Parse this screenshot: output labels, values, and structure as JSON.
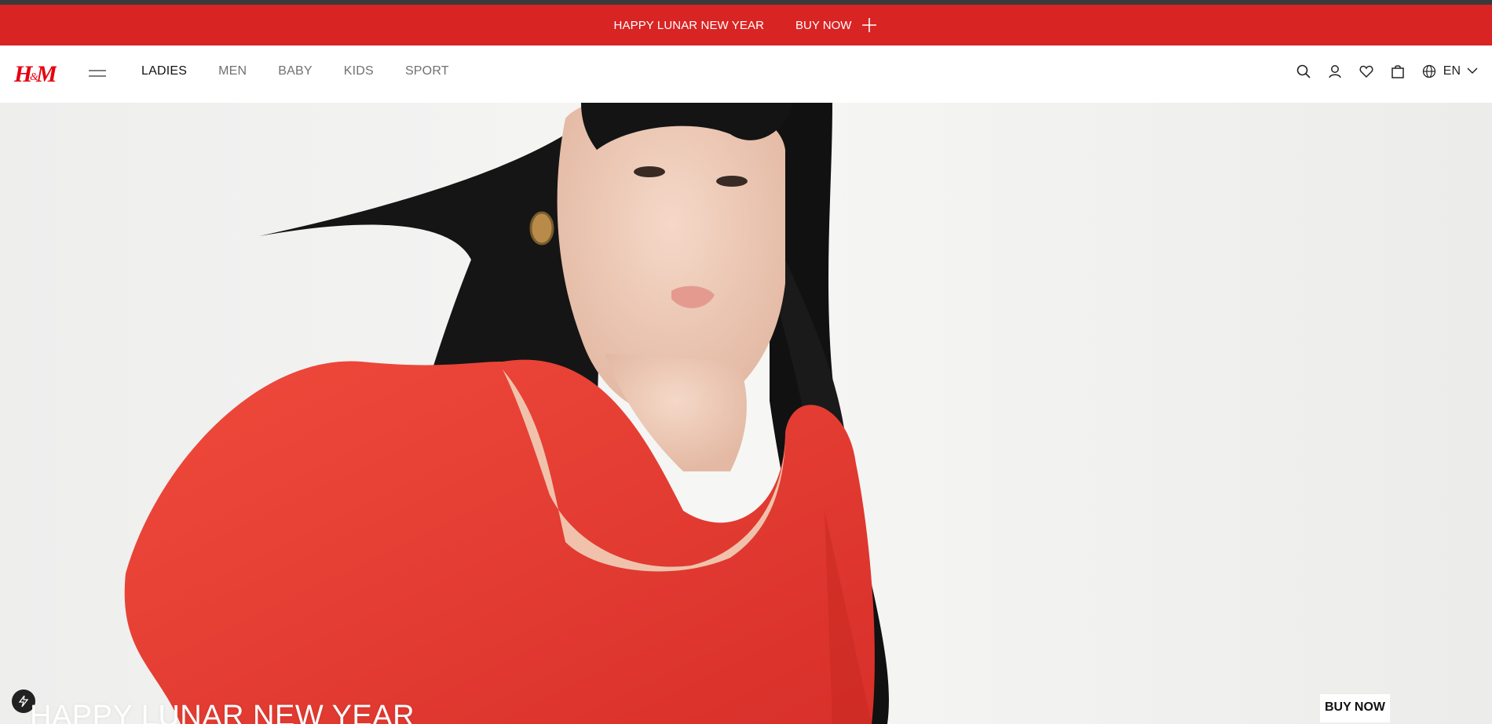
{
  "promo": {
    "text": "HAPPY LUNAR NEW YEAR",
    "link_label": "BUY NOW",
    "background": "#d92424"
  },
  "header": {
    "logo_alt": "H&M",
    "nav": [
      {
        "label": "LADIES",
        "active": true
      },
      {
        "label": "MEN"
      },
      {
        "label": "BABY"
      },
      {
        "label": "KIDS"
      },
      {
        "label": "SPORT"
      }
    ],
    "icons": [
      "search-icon",
      "account-icon",
      "heart-icon",
      "bag-icon",
      "globe-icon"
    ],
    "language": "EN"
  },
  "hero": {
    "title": "HAPPY LUNAR NEW YEAR",
    "button_label": "BUY NOW"
  }
}
